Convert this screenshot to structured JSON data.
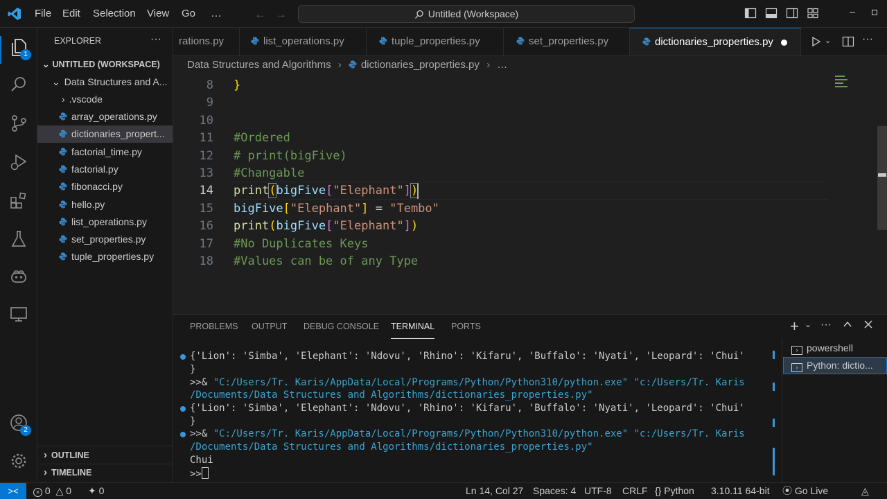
{
  "menu": [
    "File",
    "Edit",
    "Selection",
    "View",
    "Go",
    "…"
  ],
  "command_center": "Untitled (Workspace)",
  "activity_badges": {
    "explorer": "1",
    "accounts": "2"
  },
  "explorer": {
    "title": "EXPLORER",
    "workspace": "UNTITLED (WORKSPACE)",
    "folder": "Data Structures and A...",
    "subfolder": ".vscode",
    "files": [
      "array_operations.py",
      "dictionaries_propert...",
      "factorial_time.py",
      "factorial.py",
      "fibonacci.py",
      "hello.py",
      "list_operations.py",
      "set_properties.py",
      "tuple_properties.py"
    ],
    "outline": "OUTLINE",
    "timeline": "TIMELINE"
  },
  "tabs": [
    "rations.py",
    "list_operations.py",
    "tuple_properties.py",
    "set_properties.py",
    "dictionaries_properties.py"
  ],
  "breadcrumb": {
    "folder": "Data Structures and Algorithms",
    "file": "dictionaries_properties.py",
    "more": "…"
  },
  "editor": {
    "line_numbers": [
      "8",
      "9",
      "10",
      "11",
      "12",
      "13",
      "14",
      "15",
      "16",
      "17",
      "18"
    ],
    "current_line": "14",
    "lines": {
      "l8": "}",
      "l11": "#Ordered",
      "l12": "# print(bigFive)",
      "l13": "#Changable",
      "l14_fn": "print",
      "l14_var": "bigFive",
      "l14_str": "\"Elephant\"",
      "l15_var": "bigFive",
      "l15_key": "\"Elephant\"",
      "l15_eq": " = ",
      "l15_val": "\"Tembo\"",
      "l16_fn": "print",
      "l16_var": "bigFive",
      "l16_str": "\"Elephant\"",
      "l17": "#No Duplicates Keys",
      "l18": "#Values can be of any Type"
    }
  },
  "panel": {
    "tabs": [
      "PROBLEMS",
      "OUTPUT",
      "DEBUG CONSOLE",
      "TERMINAL",
      "PORTS"
    ],
    "active_tab": "TERMINAL",
    "terminal": {
      "dict_line": "{'Lion': 'Simba', 'Elephant': 'Ndovu', 'Rhino': 'Kifaru', 'Buffalo': 'Nyati', 'Leopard': 'Chui'",
      "close_brace": "}",
      "prompt": ">>& ",
      "cmd_part1": "\"C:/Users/Tr. Karis/AppData/Local/Programs/Python/Python310/python.exe\" \"c:/Users/Tr. Karis",
      "cmd_part2": "/Documents/Data Structures and Algorithms/dictionaries_properties.py\"",
      "output": "Chui",
      "final_prompt": ">>"
    },
    "terminal_list": [
      "powershell",
      "Python: dictio..."
    ]
  },
  "status": {
    "errors": "0",
    "warnings": "0",
    "ports": "0",
    "position": "Ln 14, Col 27",
    "spaces": "Spaces: 4",
    "encoding": "UTF-8",
    "eol": "CRLF",
    "language": "Python",
    "interpreter": "3.10.11 64-bit",
    "golive": "Go Live"
  },
  "colors": {
    "accent": "#0078d4",
    "background": "#1f1f1f",
    "sidebar": "#181818"
  }
}
